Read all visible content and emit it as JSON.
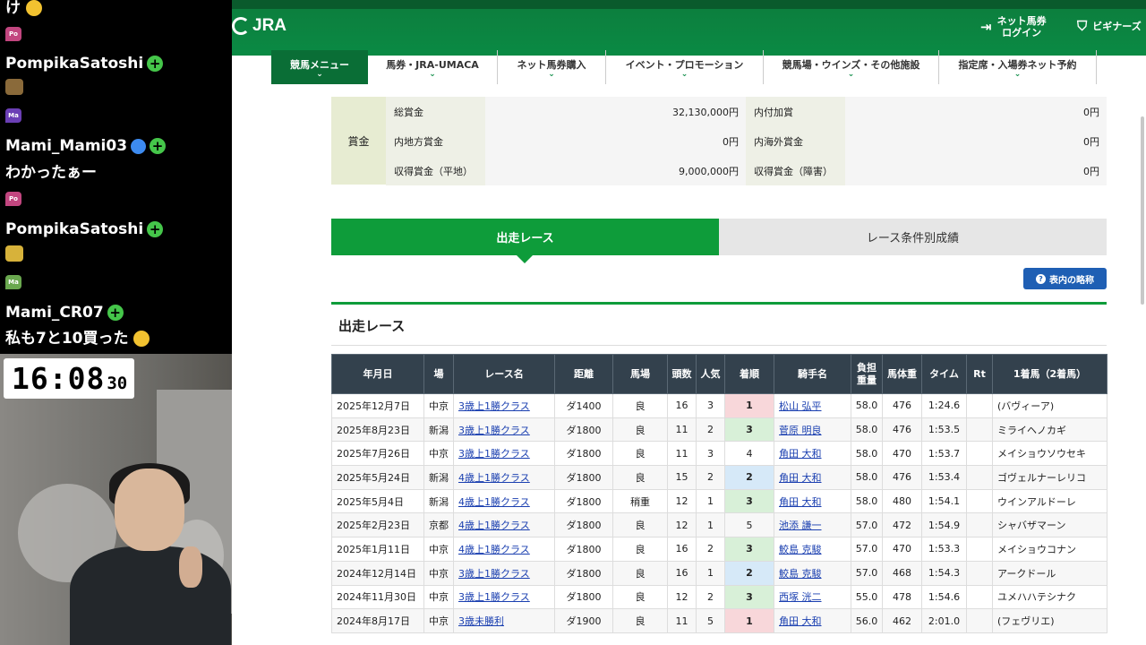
{
  "chat": {
    "top_text": "け",
    "messages": [
      {
        "badge": "Po",
        "name": "PompikaSatoshi",
        "text": ""
      },
      {
        "badge": "Ma",
        "name": "Mami_Mami03",
        "text": "わかったぁー"
      },
      {
        "badge": "Po",
        "name": "PompikaSatoshi",
        "text": ""
      },
      {
        "badge": "Ma",
        "name": "Mami_CR07",
        "text": "私も7と10買った"
      }
    ]
  },
  "clock": {
    "time": "16:08",
    "seconds": "30"
  },
  "header": {
    "logo": "JRA",
    "login_line1": "ネット馬券",
    "login_line2": "ログイン",
    "beginner": "ビギナーズ"
  },
  "nav": [
    "競馬メニュー",
    "馬券・JRA-UMACA",
    "ネット馬券購入",
    "イベント・プロモーション",
    "競馬場・ウインズ・その他施設",
    "指定席・入場券ネット予約"
  ],
  "prize": {
    "label": "賞金",
    "rows": [
      {
        "k1": "総賞金",
        "v1": "32,130,000円",
        "k2": "内付加賞",
        "v2": "0円"
      },
      {
        "k1": "内地方賞金",
        "v1": "0円",
        "k2": "内海外賞金",
        "v2": "0円"
      },
      {
        "k1": "収得賞金（平地）",
        "v1": "9,000,000円",
        "k2": "収得賞金（障害）",
        "v2": "0円"
      }
    ]
  },
  "tabs": {
    "active": "出走レース",
    "inactive": "レース条件別成績"
  },
  "legend_button": "表内の略称",
  "section_title": "出走レース",
  "table": {
    "headers": [
      "年月日",
      "場",
      "レース名",
      "距離",
      "馬場",
      "頭数",
      "人気",
      "着順",
      "騎手名",
      "負担重量",
      "馬体重",
      "タイム",
      "Rt",
      "1着馬（2着馬）"
    ],
    "rows": [
      [
        "2025年12月7日",
        "中京",
        "3歳上1勝クラス",
        "ダ1400",
        "良",
        "16",
        "3",
        "1",
        "松山 弘平",
        "58.0",
        "476",
        "1:24.6",
        "",
        "(バヴィーア)"
      ],
      [
        "2025年8月23日",
        "新潟",
        "3歳上1勝クラス",
        "ダ1800",
        "良",
        "11",
        "2",
        "3",
        "菅原 明良",
        "58.0",
        "476",
        "1:53.5",
        "",
        "ミライヘノカギ"
      ],
      [
        "2025年7月26日",
        "中京",
        "3歳上1勝クラス",
        "ダ1800",
        "良",
        "11",
        "3",
        "4",
        "角田 大和",
        "58.0",
        "470",
        "1:53.7",
        "",
        "メイショウソウセキ"
      ],
      [
        "2025年5月24日",
        "新潟",
        "4歳上1勝クラス",
        "ダ1800",
        "良",
        "15",
        "2",
        "2",
        "角田 大和",
        "58.0",
        "476",
        "1:53.4",
        "",
        "ゴヴェルナーレリコ"
      ],
      [
        "2025年5月4日",
        "新潟",
        "4歳上1勝クラス",
        "ダ1800",
        "稍重",
        "12",
        "1",
        "3",
        "角田 大和",
        "58.0",
        "480",
        "1:54.1",
        "",
        "ウインアルドーレ"
      ],
      [
        "2025年2月23日",
        "京都",
        "4歳上1勝クラス",
        "ダ1800",
        "良",
        "12",
        "1",
        "5",
        "池添 謙一",
        "57.0",
        "472",
        "1:54.9",
        "",
        "シャバザマーン"
      ],
      [
        "2025年1月11日",
        "中京",
        "4歳上1勝クラス",
        "ダ1800",
        "良",
        "16",
        "2",
        "3",
        "鮫島 克駿",
        "57.0",
        "470",
        "1:53.3",
        "",
        "メイショウコナン"
      ],
      [
        "2024年12月14日",
        "中京",
        "3歳上1勝クラス",
        "ダ1800",
        "良",
        "16",
        "1",
        "2",
        "鮫島 克駿",
        "57.0",
        "468",
        "1:54.3",
        "",
        "アークドール"
      ],
      [
        "2024年11月30日",
        "中京",
        "3歳上1勝クラス",
        "ダ1800",
        "良",
        "12",
        "2",
        "3",
        "西塚 洸二",
        "55.0",
        "478",
        "1:54.6",
        "",
        "ユメハハテシナク"
      ],
      [
        "2024年8月17日",
        "中京",
        "3歳未勝利",
        "ダ1900",
        "良",
        "11",
        "5",
        "1",
        "角田 大和",
        "56.0",
        "462",
        "2:01.0",
        "",
        "(フェヴリエ)"
      ]
    ]
  }
}
